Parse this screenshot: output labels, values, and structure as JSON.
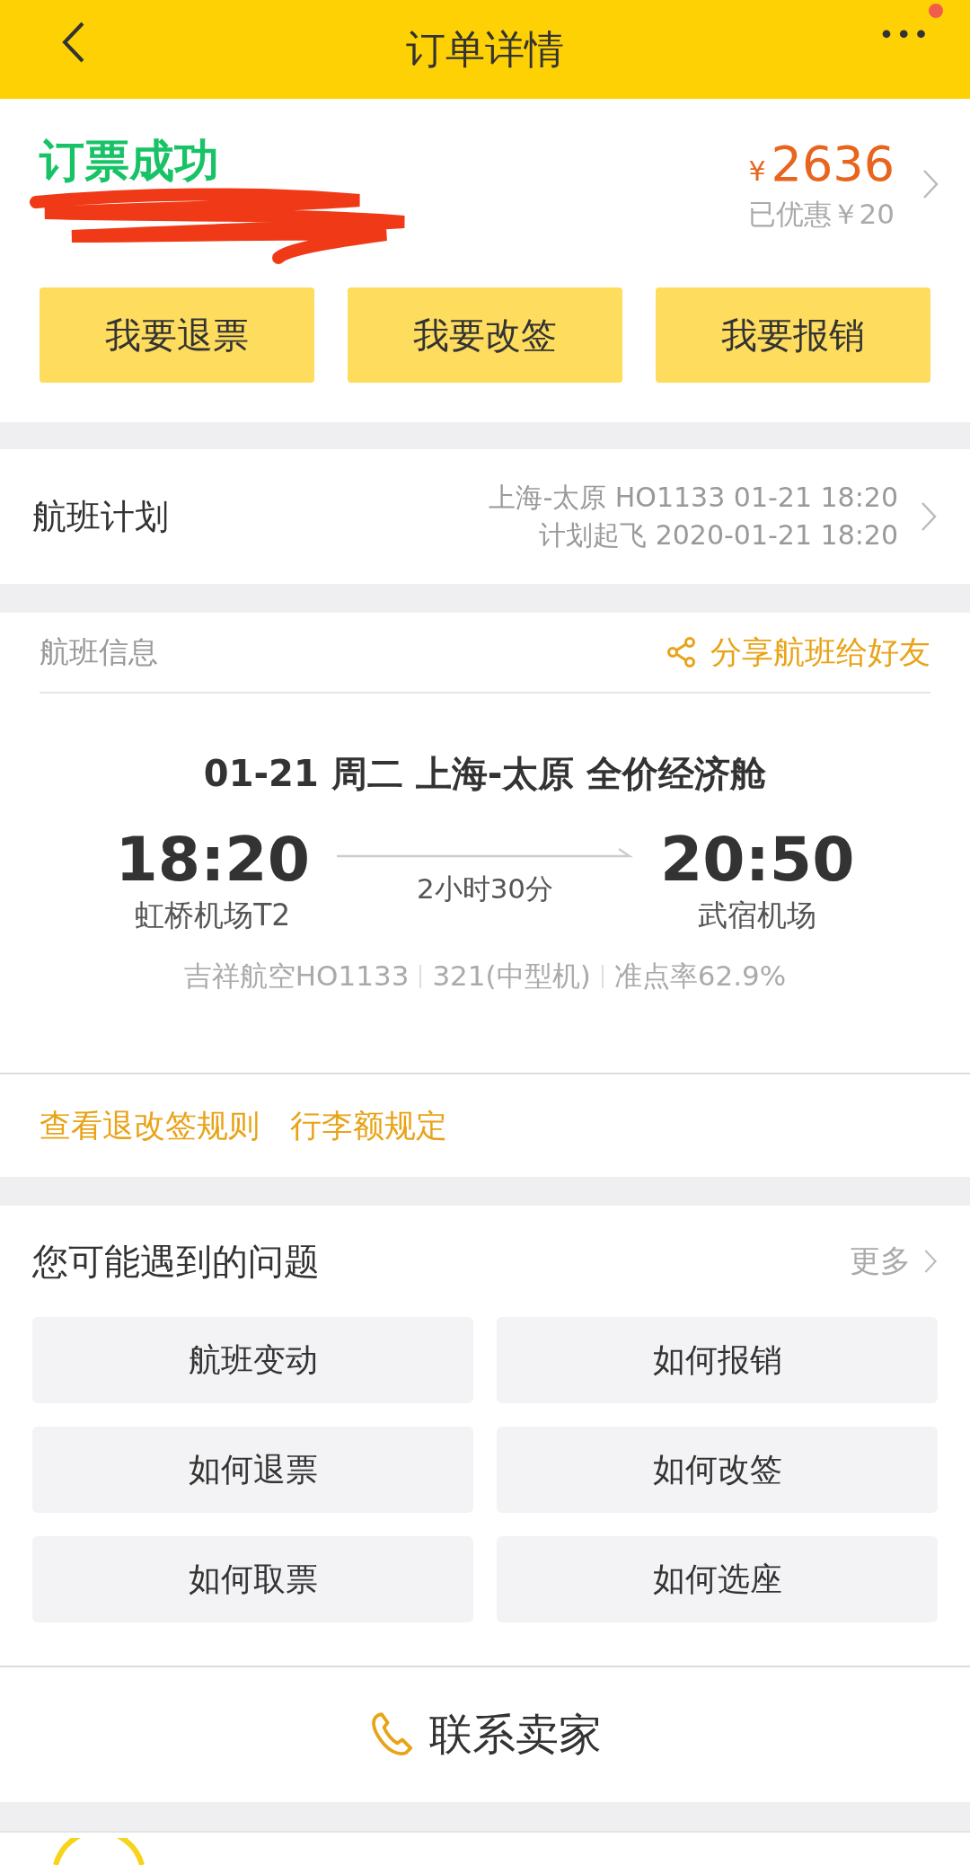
{
  "header": {
    "title": "订单详情",
    "notification_dot": true
  },
  "status": {
    "title": "订票成功",
    "currency": "¥",
    "price": "2636",
    "discount": "已优惠￥20"
  },
  "actions": [
    "我要退票",
    "我要改签",
    "我要报销"
  ],
  "flight_plan": {
    "label": "航班计划",
    "line_1": "上海-太原 HO1133 01-21 18:20",
    "line_2": "计划起飞 2020-01-21 18:20"
  },
  "flight_info": {
    "heading": "航班信息",
    "share": "分享航班给好友",
    "route": "01-21  周二  上海-太原  全价经济舱",
    "depart_time": "18:20",
    "depart_airport": "虹桥机场T2",
    "duration": "2小时30分",
    "arrive_time": "20:50",
    "arrive_airport": "武宿机场",
    "meta": [
      "吉祥航空HO1133",
      "321(中型机)",
      "准点率62.9%"
    ]
  },
  "links": [
    "查看退改签规则",
    "行李额规定"
  ],
  "questions": {
    "title": "您可能遇到的问题",
    "more": "更多",
    "items": [
      "航班变动",
      "如何报销",
      "如何退票",
      "如何改签",
      "如何取票",
      "如何选座"
    ]
  },
  "contact": {
    "label": "联系卖家"
  }
}
